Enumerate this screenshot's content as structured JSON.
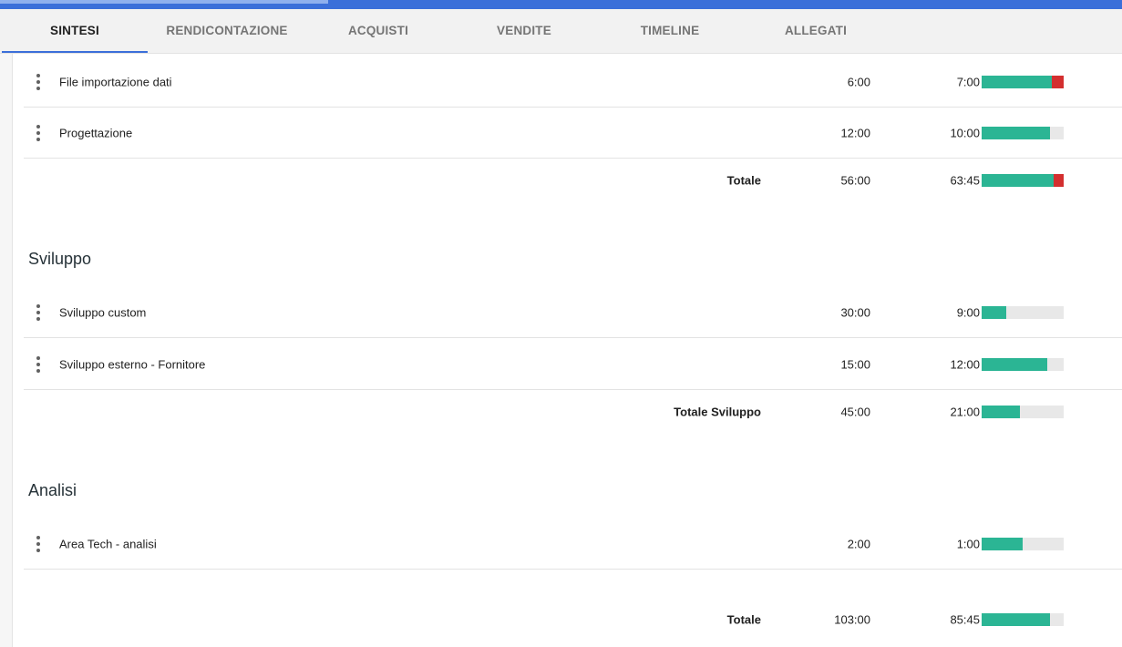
{
  "tabs": [
    {
      "label": "SINTESI",
      "active": true
    },
    {
      "label": "RENDICONTAZIONE",
      "active": false
    },
    {
      "label": "ACQUISTI",
      "active": false
    },
    {
      "label": "VENDITE",
      "active": false
    },
    {
      "label": "TIMELINE",
      "active": false
    },
    {
      "label": "ALLEGATI",
      "active": false
    }
  ],
  "colors": {
    "accent": "#3b6fd9",
    "progress_ok": "#2bb594",
    "progress_over": "#d32f2f",
    "progress_track": "#e8e8e8"
  },
  "groups": [
    {
      "title": "",
      "items": [
        {
          "label": "File importazione dati",
          "planned": "6:00",
          "actual": "7:00",
          "progress": 0.86,
          "over": 0.14
        },
        {
          "label": "Progettazione",
          "planned": "12:00",
          "actual": "10:00",
          "progress": 0.83,
          "over": 0
        }
      ],
      "total": {
        "label": "Totale",
        "planned": "56:00",
        "actual": "63:45",
        "progress": 0.88,
        "over": 0.12
      }
    },
    {
      "title": "Sviluppo",
      "items": [
        {
          "label": "Sviluppo custom",
          "planned": "30:00",
          "actual": "9:00",
          "progress": 0.3,
          "over": 0
        },
        {
          "label": "Sviluppo esterno - Fornitore",
          "planned": "15:00",
          "actual": "12:00",
          "progress": 0.8,
          "over": 0
        }
      ],
      "total": {
        "label": "Totale Sviluppo",
        "planned": "45:00",
        "actual": "21:00",
        "progress": 0.47,
        "over": 0
      }
    },
    {
      "title": "Analisi",
      "items": [
        {
          "label": "Area Tech - analisi",
          "planned": "2:00",
          "actual": "1:00",
          "progress": 0.5,
          "over": 0
        }
      ]
    }
  ],
  "grand_total": {
    "label": "Totale",
    "planned": "103:00",
    "actual": "85:45",
    "progress": 0.83,
    "over": 0
  }
}
